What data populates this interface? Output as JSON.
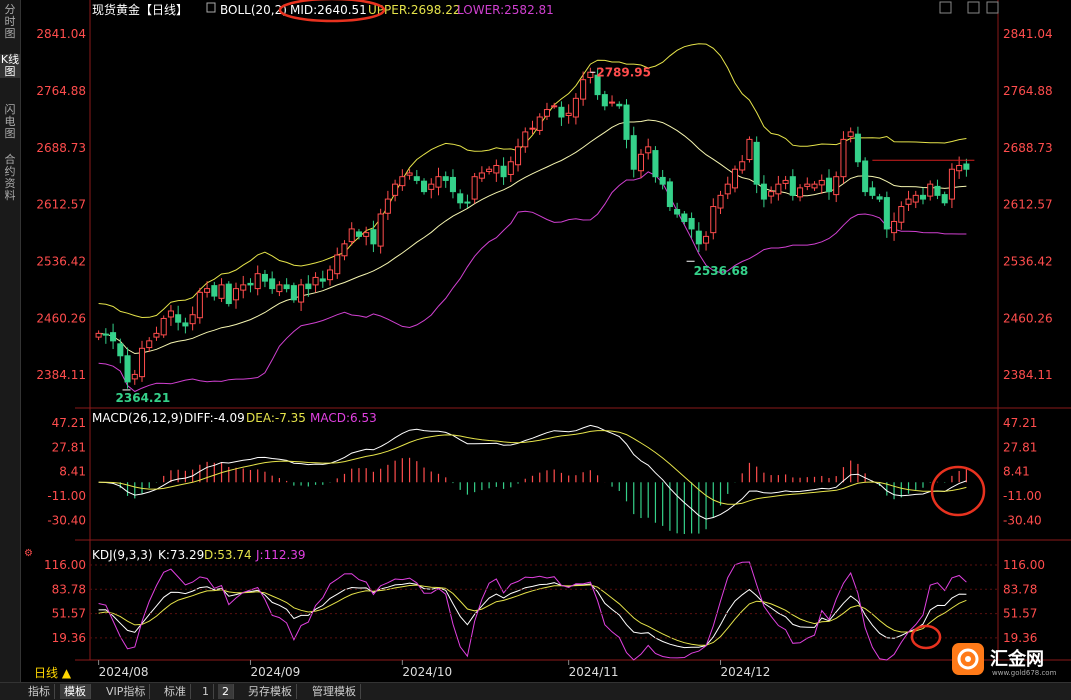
{
  "left_tabs": [
    "分时图",
    "K线图",
    "闪电图",
    "合约资料"
  ],
  "active_left_tab": 1,
  "bottom_tabs": [
    "指标",
    "模板",
    "VIP指标",
    "标准",
    "1",
    "2",
    "另存模板",
    "管理模板"
  ],
  "active_bottom_tabs": [
    1,
    5
  ],
  "period_label": "日线 ▲",
  "logo": {
    "text": "汇金网",
    "sub": "www.gold678.com"
  },
  "colors": {
    "up": "#ff4d4d",
    "down": "#35d18a",
    "mid": "#f5f5b0",
    "upper": "#e5e34a",
    "lower": "#d040d0",
    "axis": "#ff4d4d",
    "dea": "#e5e34a",
    "k": "#ffffff",
    "d": "#e5e34a",
    "j": "#e040e0"
  },
  "main_panel": {
    "title": "现货黄金【日线】",
    "boll_label": "BOLL(20,2)",
    "mid_label": "MID:2640.51",
    "upper_label": "UPPER:2698.22",
    "lower_label": "LOWER:2582.81",
    "y_ticks": [
      "2841.04",
      "2764.88",
      "2688.73",
      "2612.57",
      "2536.42",
      "2460.26",
      "2384.11"
    ],
    "annotations": [
      {
        "text": "2789.95",
        "color": "#ff4d4d"
      },
      {
        "text": "2536.68",
        "color": "#35d18a"
      },
      {
        "text": "2364.21",
        "color": "#35d18a"
      }
    ]
  },
  "macd_panel": {
    "title": "MACD(26,12,9)",
    "diff_label": "DIFF:-4.09",
    "dea_label": "DEA:-7.35",
    "macd_label": "MACD:6.53",
    "y_ticks": [
      "47.21",
      "27.81",
      "8.41",
      "-11.00",
      "-30.40"
    ]
  },
  "kdj_panel": {
    "title": "KDJ(9,3,3)",
    "k_label": "K:73.29",
    "d_label": "D:53.74",
    "j_label": "J:112.39",
    "y_ticks": [
      "116.00",
      "83.78",
      "51.57",
      "19.36"
    ]
  },
  "chart_data": {
    "type": "candlestick",
    "x_labels": [
      "2024/08",
      "2024/09",
      "2024/10",
      "2024/11",
      "2024/12"
    ],
    "y_range": [
      2340,
      2860
    ],
    "y_ticks": [
      2841.04,
      2764.88,
      2688.73,
      2612.57,
      2536.42,
      2460.26,
      2384.11
    ],
    "highlighted_high": 2789.95,
    "highlighted_lows": [
      2536.68,
      2364.21
    ],
    "close": [
      2440,
      2438,
      2430,
      2410,
      2375,
      2385,
      2420,
      2430,
      2440,
      2460,
      2470,
      2455,
      2450,
      2465,
      2495,
      2500,
      2490,
      2505,
      2480,
      2500,
      2505,
      2505,
      2520,
      2510,
      2500,
      2505,
      2500,
      2485,
      2505,
      2500,
      2515,
      2510,
      2525,
      2545,
      2560,
      2580,
      2570,
      2575,
      2560,
      2600,
      2620,
      2640,
      2650,
      2655,
      2645,
      2630,
      2640,
      2650,
      2645,
      2630,
      2615,
      2615,
      2650,
      2655,
      2660,
      2665,
      2650,
      2670,
      2690,
      2710,
      2715,
      2730,
      2740,
      2745,
      2730,
      2735,
      2755,
      2780,
      2790,
      2760,
      2745,
      2750,
      2745,
      2700,
      2660,
      2680,
      2690,
      2650,
      2640,
      2610,
      2600,
      2590,
      2580,
      2560,
      2570,
      2610,
      2625,
      2640,
      2660,
      2670,
      2700,
      2640,
      2620,
      2630,
      2640,
      2645,
      2625,
      2635,
      2640,
      2640,
      2645,
      2630,
      2650,
      2700,
      2710,
      2670,
      2630,
      2625,
      2620,
      2580,
      2590,
      2610,
      2620,
      2625,
      2620,
      2640,
      2625,
      2615,
      2660,
      2665,
      2660
    ]
  }
}
